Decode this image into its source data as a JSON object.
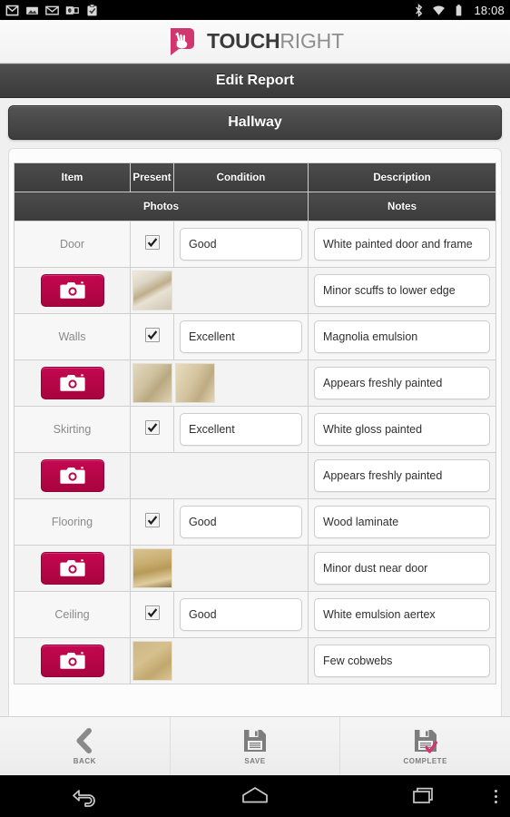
{
  "statusbar": {
    "time": "18:08",
    "left_icons": [
      "gmail-icon",
      "photo-icon",
      "envelope-icon",
      "outlook-icon",
      "clipboard-check-icon"
    ],
    "right_icons": [
      "bluetooth-icon",
      "wifi-icon",
      "battery-icon"
    ]
  },
  "brand": {
    "name_bold": "TOUCH",
    "name_light": "RIGHT",
    "logo_color": "#d1366f",
    "logo_name": "touchright-hand-logo"
  },
  "title": "Edit Report",
  "section": {
    "label": "Hallway"
  },
  "table": {
    "header_row_1": [
      "Item",
      "Present",
      "Condition",
      "Description"
    ],
    "header_row_2": [
      "Photos",
      "Notes"
    ],
    "rows": [
      {
        "item": "Door",
        "present": true,
        "condition": "Good",
        "description": "White painted door and frame",
        "notes": "Minor scuffs to lower edge",
        "camera_label": "camera-button",
        "photos": [
          "door-hinge-photo"
        ]
      },
      {
        "item": "Walls",
        "present": true,
        "condition": "Excellent",
        "description": "Magnolia emulsion",
        "notes": "Appears freshly painted",
        "camera_label": "camera-button",
        "photos": [
          "wall-corner-photo",
          "wall-edge-photo"
        ]
      },
      {
        "item": "Skirting",
        "present": true,
        "condition": "Excellent",
        "description": "White gloss painted",
        "notes": "Appears freshly painted",
        "camera_label": "camera-button",
        "photos": []
      },
      {
        "item": "Flooring",
        "present": true,
        "condition": "Good",
        "description": "Wood laminate",
        "notes": "Minor dust near door",
        "camera_label": "camera-button",
        "photos": [
          "laminate-floor-photo"
        ]
      },
      {
        "item": "Ceiling",
        "present": true,
        "condition": "Good",
        "description": "White emulsion aertex",
        "notes": "Few cobwebs",
        "camera_label": "camera-button",
        "photos": [
          "ceiling-photo"
        ]
      }
    ]
  },
  "actions": [
    {
      "label": "BACK",
      "icon": "chevron-left-icon"
    },
    {
      "label": "SAVE",
      "icon": "floppy-disk-icon"
    },
    {
      "label": "COMPLETE",
      "icon": "floppy-disk-check-icon"
    }
  ],
  "navbar": {
    "buttons": [
      "back-arrow-icon",
      "home-icon",
      "recents-icon",
      "overflow-menu-icon"
    ]
  },
  "colors": {
    "accent": "#c4074f",
    "header_dark": "#3c3c3c",
    "check_accent": "#d1366f"
  }
}
